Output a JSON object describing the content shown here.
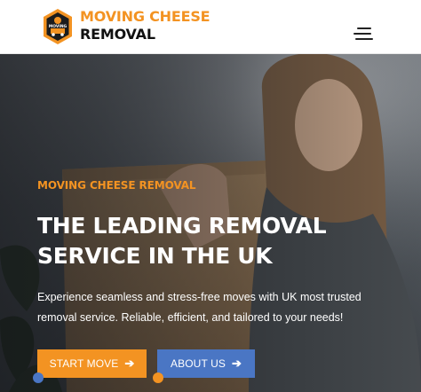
{
  "header": {
    "logo_text": "MOVING",
    "brand_line1": "MOVING CHEESE",
    "brand_line2": "REMOVAL",
    "menu_icon": "hamburger-icon"
  },
  "hero": {
    "eyebrow": "MOVING CHEESE REMOVAL",
    "headline_line1": "THE LEADING REMOVAL",
    "headline_line2": "SERVICE IN THE UK",
    "description_line1": "Experience seamless and stress-free moves with UK most trusted",
    "description_line2": "removal service. Reliable, efficient, and tailored to your needs!",
    "buttons": [
      {
        "label": "START MOVE",
        "icon": "arrow-right-icon"
      },
      {
        "label": "ABOUT US",
        "icon": "arrow-right-icon"
      }
    ]
  },
  "colors": {
    "accent_orange": "#f39322",
    "accent_blue": "#4a76c4",
    "header_bg": "#ffffff",
    "text_dark": "#111111"
  }
}
